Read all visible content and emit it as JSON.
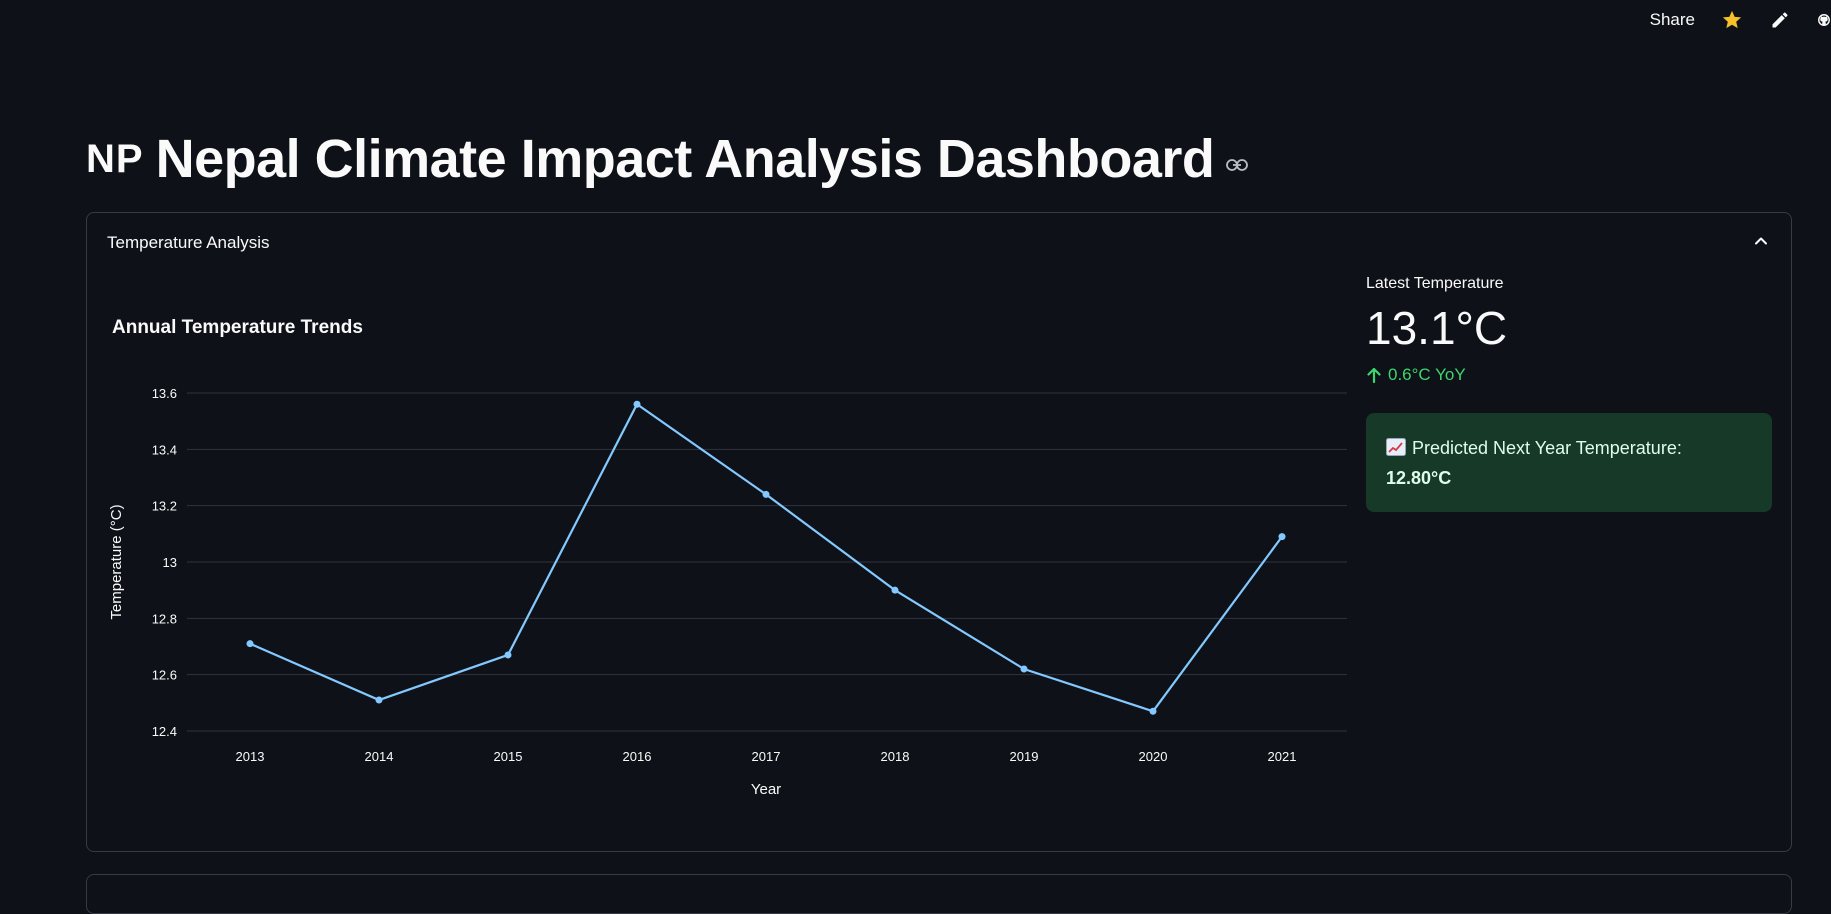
{
  "header": {
    "share_label": "Share",
    "icons": [
      "star-icon",
      "edit-icon",
      "github-icon"
    ]
  },
  "page": {
    "flag_text": "NP",
    "title": "Nepal Climate Impact Analysis Dashboard"
  },
  "expander": {
    "label": "Temperature Analysis",
    "state": "expanded"
  },
  "chart_section": {
    "title": "Annual Temperature Trends"
  },
  "metric": {
    "label": "Latest Temperature",
    "value": "13.1°C",
    "delta": "0.6°C YoY",
    "delta_color": "#3dd56d"
  },
  "prediction": {
    "emoji": "chart-increasing-icon",
    "label": "Predicted Next Year Temperature:",
    "value": "12.80°C"
  },
  "colors": {
    "background": "#0e1117",
    "line": "#83c9ff",
    "success_bg": "#173928",
    "star": "#f6c02a"
  },
  "chart_data": {
    "type": "line",
    "title": "",
    "xlabel": "Year",
    "ylabel": "Temperature (°C)",
    "x": [
      2013,
      2014,
      2015,
      2016,
      2017,
      2018,
      2019,
      2020,
      2021
    ],
    "series": [
      {
        "values": [
          12.71,
          12.51,
          12.67,
          13.56,
          13.24,
          12.9,
          12.62,
          12.47,
          13.09
        ]
      }
    ],
    "ylim": [
      12.4,
      13.6
    ],
    "yticks": [
      12.4,
      12.6,
      12.8,
      13,
      13.2,
      13.4,
      13.6
    ],
    "ytick_labels": [
      "12.4",
      "12.6",
      "12.8",
      "13",
      "13.2",
      "13.4",
      "13.6"
    ],
    "grid": true,
    "markers": true
  }
}
